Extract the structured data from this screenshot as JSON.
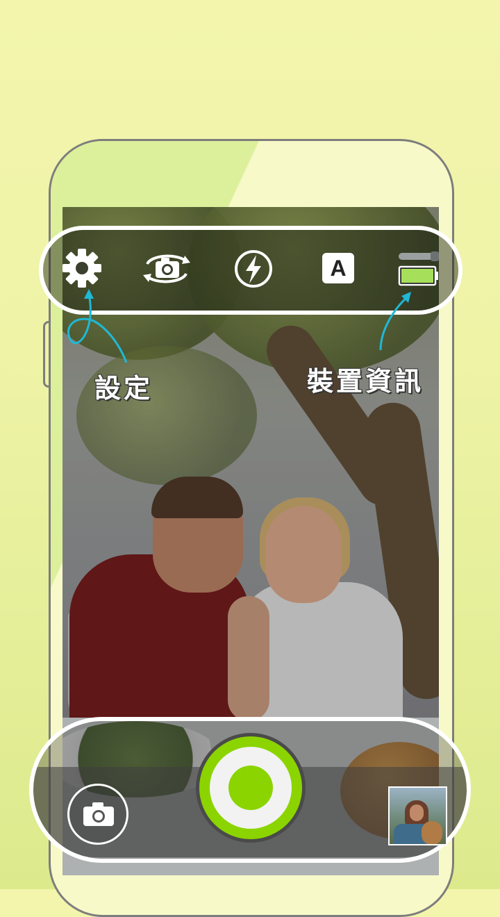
{
  "app": {
    "accent_color": "#8bd400",
    "background_color": "#f1f5aa"
  },
  "top_bar": {
    "items": [
      {
        "name": "settings",
        "icon": "gear-icon"
      },
      {
        "name": "switch-camera",
        "icon": "camera-rotate-icon"
      },
      {
        "name": "flash",
        "icon": "flash-auto-icon"
      },
      {
        "name": "auto-mode",
        "icon": "auto-mode-icon",
        "text": "A"
      },
      {
        "name": "device-info",
        "icon": "battery-icon",
        "level": 1.0
      }
    ]
  },
  "callouts": {
    "settings_label": "設定",
    "device_info_label": "裝置資訊",
    "line_color": "#1fb8d6"
  },
  "bottom_bar": {
    "left_icon": "camera-icon",
    "shutter_icon": "shutter-button",
    "gallery_icon": "gallery-thumbnail"
  }
}
